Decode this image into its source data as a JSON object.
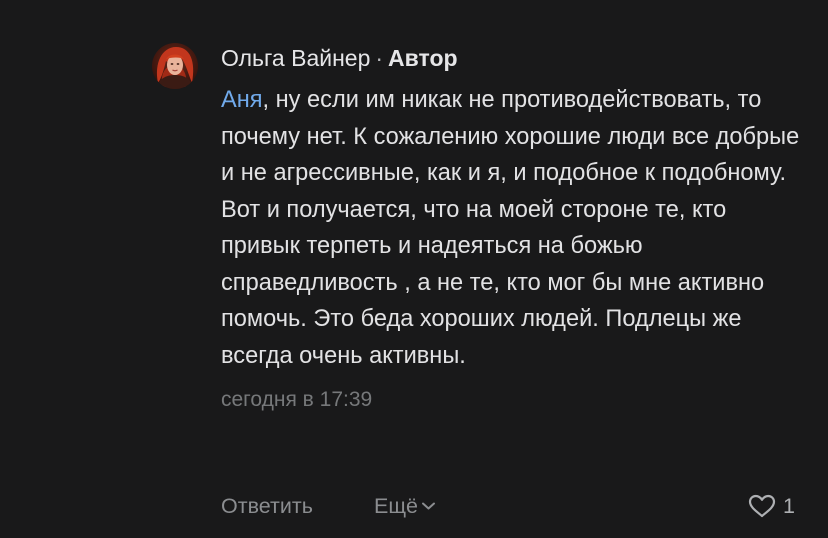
{
  "comment": {
    "author": "Ольга Вайнер",
    "separator": "·",
    "badge": "Автор",
    "mention": "Аня",
    "text": ", ну если им никак не противодействовать, то почему нет. К сожалению хорошие люди все добрые и не агрессивные, как и я, и подобное к подобному. Вот и получается, что на моей стороне те, кто привык терпеть и надеяться на божью справедливость , а не те, кто мог бы мне активно помочь. Это беда хороших людей. Подлецы же всегда очень активны.",
    "timestamp": "сегодня в 17:39"
  },
  "actions": {
    "reply_label": "Ответить",
    "more_label": "Ещё",
    "more_icon": "chevron-down-icon",
    "like_icon": "heart-icon",
    "like_count": "1"
  },
  "colors": {
    "background": "#19191a",
    "mention": "#71aaeb",
    "muted": "#76787a"
  }
}
